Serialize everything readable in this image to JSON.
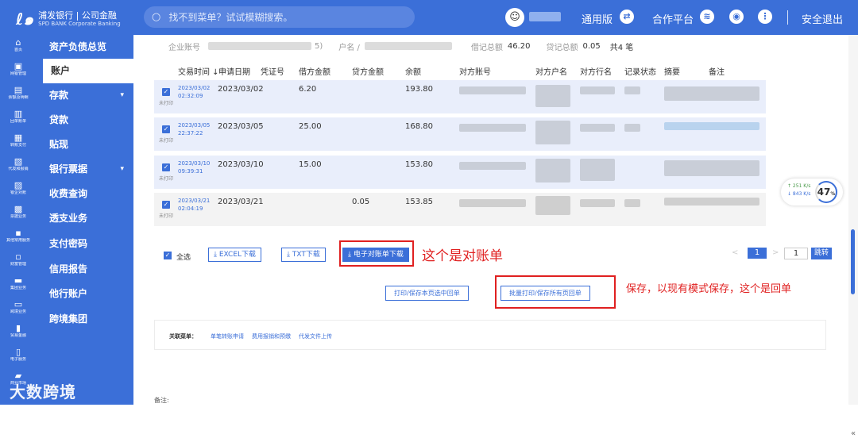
{
  "header": {
    "logo_cn": "浦发银行 | 公司金融",
    "logo_en": "SPD BANK   Corporate Banking",
    "search_placeholder": "找不到菜单？试试模糊搜索。",
    "version": "通用版",
    "partner": "合作平台",
    "logout": "安全退出"
  },
  "rail": [
    {
      "icon": "⌂",
      "label": "首页"
    },
    {
      "icon": "▣",
      "label": "网银管理"
    },
    {
      "icon": "▤",
      "label": "余额及明细"
    },
    {
      "icon": "▥",
      "label": "回单账单"
    },
    {
      "icon": "▦",
      "label": "转账支付"
    },
    {
      "icon": "▧",
      "label": "代发和报销"
    },
    {
      "icon": "▨",
      "label": "银企对账"
    },
    {
      "icon": "▩",
      "label": "票据业务"
    },
    {
      "icon": "▪",
      "label": "其他常用服务"
    },
    {
      "icon": "▫",
      "label": "财富管理"
    },
    {
      "icon": "▬",
      "label": "集团业务"
    },
    {
      "icon": "▭",
      "label": "跨境业务"
    },
    {
      "icon": "▮",
      "label": "贸易金融"
    },
    {
      "icon": "▯",
      "label": "电子服务"
    },
    {
      "icon": "▰",
      "label": "商业市场"
    }
  ],
  "menu": [
    {
      "label": "资产负债总览",
      "caret": ""
    },
    {
      "label": "账户",
      "caret": ""
    },
    {
      "label": "存款",
      "caret": "▾"
    },
    {
      "label": "贷款",
      "caret": ""
    },
    {
      "label": "贴现",
      "caret": ""
    },
    {
      "label": "银行票据",
      "caret": "▾"
    },
    {
      "label": "收费查询",
      "caret": ""
    },
    {
      "label": "透支业务",
      "caret": ""
    },
    {
      "label": "支付密码",
      "caret": ""
    },
    {
      "label": "信用报告",
      "caret": ""
    },
    {
      "label": "他行账户",
      "caret": ""
    },
    {
      "label": "跨境集团",
      "caret": ""
    }
  ],
  "watermark": "大数跨境",
  "summary": {
    "enterprise_label": "企业账号",
    "suffix": "5)",
    "account_name_label": "户名 /",
    "debit_total_label": "借记总额",
    "debit_total": "46.20",
    "credit_total_label": "贷记总额",
    "credit_total": "0.05",
    "count": "共4 笔"
  },
  "table": {
    "columns": [
      "交易时间 ↓",
      "申请日期",
      "凭证号",
      "借方金额",
      "贷方金额",
      "余额",
      "对方账号",
      "对方户名",
      "对方行名",
      "记录状态",
      "摘要",
      "备注"
    ],
    "rows": [
      {
        "date": "2023/03/02",
        "time": "02:32:09",
        "status": "未打印",
        "apply": "2023/03/02",
        "debit": "6.20",
        "credit": "",
        "balance": "193.80"
      },
      {
        "date": "2023/03/05",
        "time": "22:37:22",
        "status": "未打印",
        "apply": "2023/03/05",
        "debit": "25.00",
        "credit": "",
        "balance": "168.80"
      },
      {
        "date": "2023/03/10",
        "time": "09:39:31",
        "status": "未打印",
        "apply": "2023/03/10",
        "debit": "15.00",
        "credit": "",
        "balance": "153.80"
      },
      {
        "date": "2023/03/21",
        "time": "02:04:19",
        "status": "未打印",
        "apply": "2023/03/21",
        "debit": "",
        "credit": "0.05",
        "balance": "153.85"
      }
    ]
  },
  "actions": {
    "select_all": "全选",
    "excel": "EXCEL下载",
    "txt": "TXT下载",
    "statement": "电子对账单下载",
    "print_page": "打印/保存本页选中回单",
    "print_all": "批量打印/保存所有页回单",
    "check": "✓"
  },
  "annotations": {
    "statement_note": "这个是对账单",
    "receipt_note": "保存，以现有模式保存，这个是回单"
  },
  "pager": {
    "prev": "<",
    "current": "1",
    "next": ">",
    "goto_value": "1",
    "jump": "跳转"
  },
  "related": {
    "label": "关联菜单：",
    "links": [
      "单笔转账申请",
      "费用报销和预缴",
      "代发文件上传"
    ]
  },
  "note_label": "备注:",
  "speed": {
    "up": "↑ 251 K/s",
    "down": "↓ 843 K/s",
    "pct": "47"
  },
  "scroll_more": "«",
  "colors": {
    "brand": "#3b6fd8",
    "annotation": "#e02020"
  }
}
